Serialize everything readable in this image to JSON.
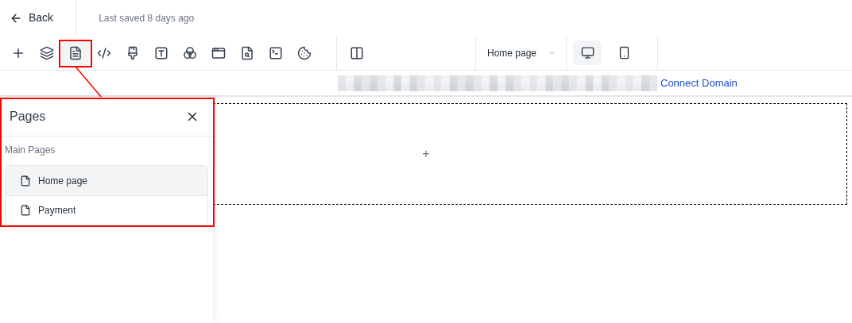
{
  "header": {
    "back": "Back",
    "saved": "Last saved 8 days ago"
  },
  "tools": [
    {
      "kind": "add",
      "selected": false
    },
    {
      "kind": "layers",
      "selected": false
    },
    {
      "kind": "pages",
      "selected": true
    },
    {
      "kind": "code",
      "selected": false
    },
    {
      "kind": "brush",
      "selected": false
    },
    {
      "kind": "text",
      "selected": false
    },
    {
      "kind": "colors",
      "selected": false
    },
    {
      "kind": "window",
      "selected": false
    },
    {
      "kind": "seo",
      "selected": false
    },
    {
      "kind": "terminal",
      "selected": false
    },
    {
      "kind": "cookie",
      "selected": false
    }
  ],
  "page_select": {
    "value": "Home page"
  },
  "devices": [
    {
      "kind": "desktop",
      "selected": true
    },
    {
      "kind": "mobile",
      "selected": false
    }
  ],
  "address_bar": {
    "link": "Connect Domain"
  },
  "panel": {
    "title": "Pages",
    "section": "Main Pages",
    "pages": [
      {
        "label": "Home page",
        "selected": true
      },
      {
        "label": "Payment",
        "selected": false
      }
    ]
  },
  "canvas": {
    "add": "+"
  }
}
